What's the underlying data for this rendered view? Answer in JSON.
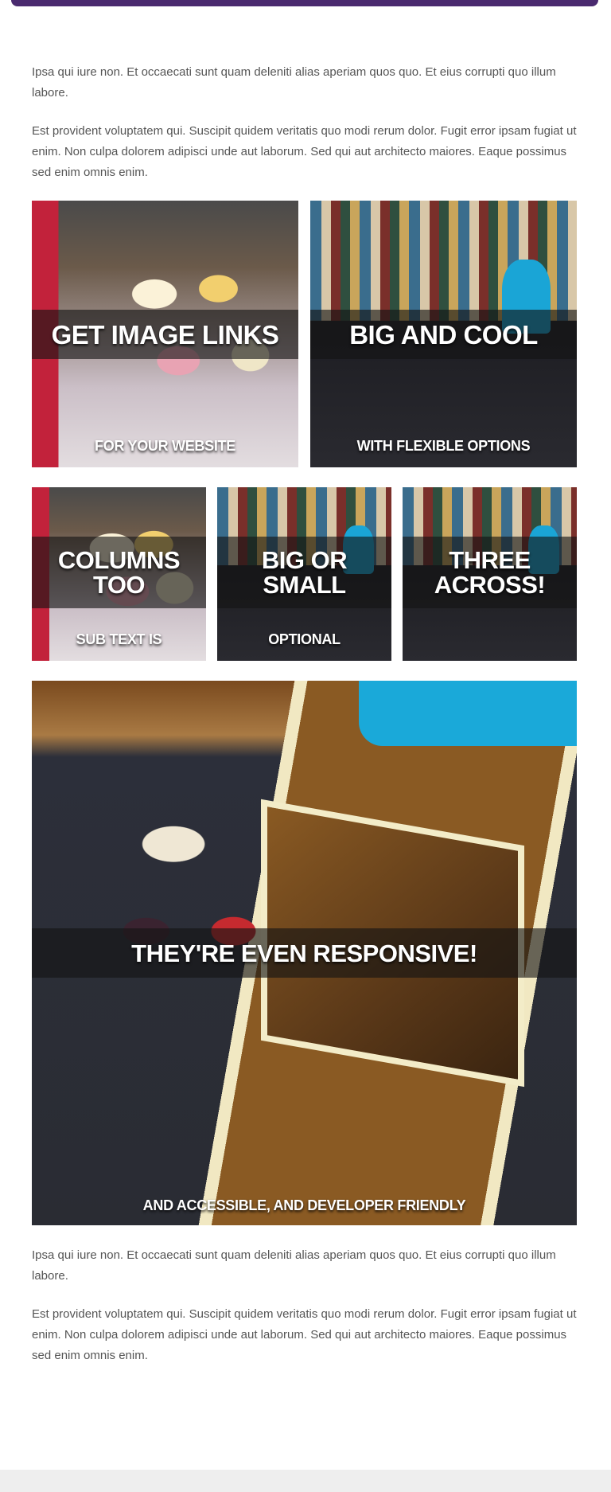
{
  "intro": {
    "p1": "Ipsa qui iure non. Et occaecati sunt quam deleniti alias aperiam quos quo. Et eius corrupti quo illum labore.",
    "p2": "Est provident voluptatem qui. Suscipit quidem veritatis quo modi rerum dolor. Fugit error ipsam fugiat ut enim. Non culpa dolorem adipisci unde aut laborum. Sed qui aut architecto maiores. Eaque possimus sed enim omnis enim."
  },
  "tiles_row1": [
    {
      "headline": "GET IMAGE LINKS",
      "sub": "FOR YOUR WEBSITE",
      "photo": "cupcakes"
    },
    {
      "headline": "BIG AND COOL",
      "sub": "WITH FLEXIBLE OPTIONS",
      "photo": "bookshelf"
    }
  ],
  "tiles_row2": [
    {
      "headline_line1": "COLUMNS",
      "headline_line2": "TOO",
      "sub": "SUB TEXT IS",
      "photo": "cupcakes"
    },
    {
      "headline_line1": "BIG OR",
      "headline_line2": "SMALL",
      "sub": "OPTIONAL",
      "photo": "bookshelf"
    },
    {
      "headline_line1": "THREE",
      "headline_line2": "ACROSS!",
      "sub": "",
      "photo": "bookshelf"
    }
  ],
  "tile_wide": {
    "headline": "THEY'RE EVEN RESPONSIVE!",
    "sub": "AND ACCESSIBLE, AND DEVELOPER FRIENDLY",
    "photo": "table-with-card"
  },
  "outro": {
    "p1": "Ipsa qui iure non. Et occaecati sunt quam deleniti alias aperiam quos quo. Et eius corrupti quo illum labore.",
    "p2": "Est provident voluptatem qui. Suscipit quidem veritatis quo modi rerum dolor. Fugit error ipsam fugiat ut enim. Non culpa dolorem adipisci unde aut laborum. Sed qui aut architecto maiores. Eaque possimus sed enim omnis enim."
  },
  "colors": {
    "header_bar": "#4a2a6f",
    "footer": "#eeeeee",
    "body_text": "#555555",
    "overlay_band": "rgba(20,20,20,0.62)"
  }
}
